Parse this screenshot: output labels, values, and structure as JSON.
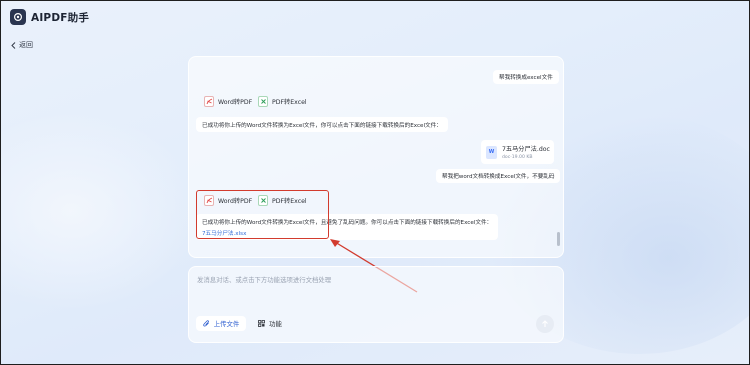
{
  "app": {
    "title": "AIPDF助手"
  },
  "nav": {
    "back_label": "返回"
  },
  "messages": {
    "user_msg_1": "帮我转换成excel文件",
    "tool_chip_word_pdf_1": "Word转PDF",
    "tool_chip_pdf_excel_1": "PDF转Excel",
    "bot_reply_1": "已成功将你上传的Word文件转换为Excel文件，你可以点击下面的链接下载转换后的Excel文件：",
    "file_card": {
      "name": "7五马分尸法.doc",
      "meta": "doc·19.00 KB"
    },
    "user_msg_2": "帮我把word文档转换成Excel文件，不要乱码",
    "tool_chip_word_pdf_2": "Word转PDF",
    "tool_chip_pdf_excel_2": "PDF转Excel",
    "bot_reply_2": "已成功将你上传的Word文件转换为Excel文件，且避免了乱码问题。你可以点击下面的链接下载转换后的Excel文件：",
    "bot_link_2": "7五马分尸法.xlsx"
  },
  "composer": {
    "placeholder": "发消息对话、或点击下方功能选项进行文档处理",
    "upload_label": "上传文件",
    "function_label": "功能"
  },
  "colors": {
    "accent": "#2f6bd8",
    "highlight": "#d23b2e",
    "pdf_icon": "#e04848",
    "excel_icon": "#2e9e5b"
  },
  "icons": [
    "app-logo-icon",
    "chevron-left-icon",
    "pdf-file-icon",
    "excel-file-icon",
    "word-doc-icon",
    "attachment-icon",
    "grid-icon",
    "send-arrow-icon"
  ]
}
